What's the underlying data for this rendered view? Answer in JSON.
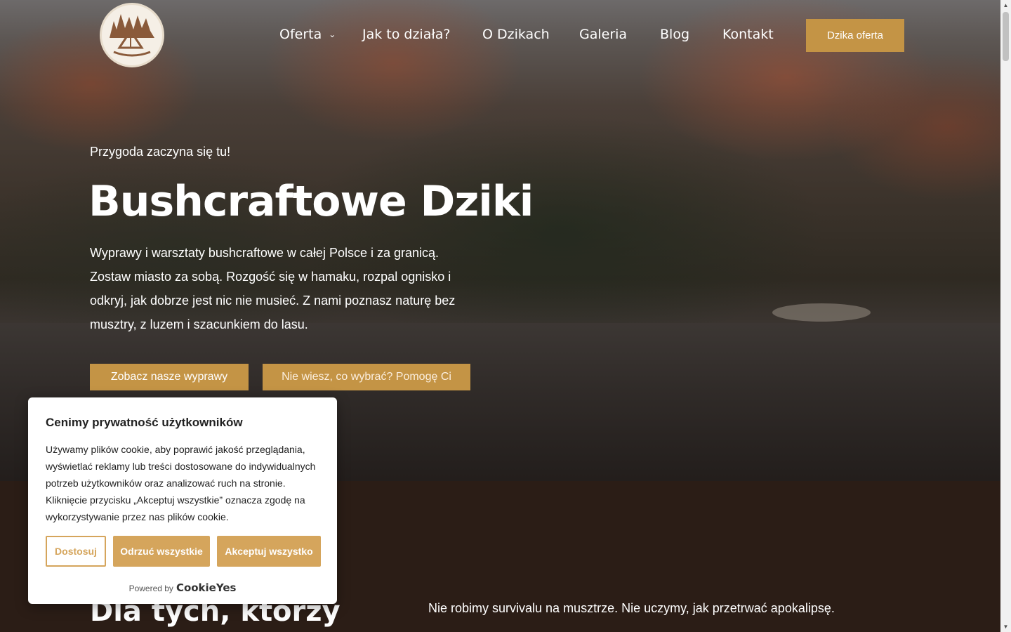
{
  "nav": {
    "items": [
      {
        "label": "Oferta",
        "has_dropdown": true
      },
      {
        "label": "Jak to działa?"
      },
      {
        "label": "O Dzikach"
      },
      {
        "label": "Galeria"
      },
      {
        "label": "Blog"
      },
      {
        "label": "Kontakt"
      }
    ],
    "cta_label": "Dzika oferta"
  },
  "hero": {
    "tagline": "Przygoda zaczyna się tu!",
    "title": "Bushcraftowe Dziki",
    "description": "Wyprawy i warsztaty bushcraftowe w całej Polsce i za granicą. Zostaw miasto za sobą. Rozgość się w hamaku, rozpal ognisko i odkryj, jak dobrze jest nic nie musieć. Z nami poznasz naturę bez musztry, z luzem i szacunkiem do lasu.",
    "button_primary": "Zobacz nasze wyprawy",
    "button_secondary": "Nie wiesz, co wybrać? Pomogę Ci"
  },
  "section": {
    "title": "Dla tych, którzy",
    "text": "Nie robimy survivalu na musztrze. Nie uczymy, jak przetrwać apokalipsę."
  },
  "cookie": {
    "title": "Cenimy prywatność użytkowników",
    "text": "Używamy plików cookie, aby poprawić jakość przeglądania, wyświetlać reklamy lub treści dostosowane do indywidualnych potrzeb użytkowników oraz analizować ruch na stronie. Kliknięcie przycisku „Akceptuj wszystkie” oznacza zgodę na wykorzystywanie przez nas plików cookie.",
    "customize_label": "Dostosuj",
    "reject_label": "Odrzuć wszystkie",
    "accept_label": "Akceptuj wszystko",
    "powered_by": "Powered by",
    "brand": "CookieYes"
  },
  "colors": {
    "accent": "#c49445",
    "cookie_accent": "#d5a55c",
    "section_bg": "#2b1d16"
  }
}
